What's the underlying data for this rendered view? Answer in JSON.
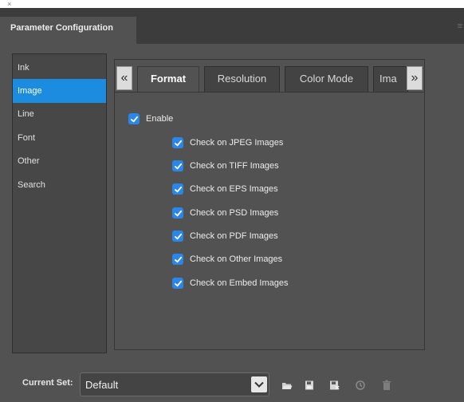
{
  "window": {
    "close_glyph": "×",
    "panel_title": "Parameter Configuration",
    "menu_glyph": "≡"
  },
  "sidebar": {
    "items": [
      {
        "label": "Ink",
        "selected": false
      },
      {
        "label": "Image",
        "selected": true
      },
      {
        "label": "Line",
        "selected": false
      },
      {
        "label": "Font",
        "selected": false
      },
      {
        "label": "Other",
        "selected": false
      },
      {
        "label": "Search",
        "selected": false
      }
    ]
  },
  "tabs": {
    "prev_glyph": "«",
    "next_glyph": "»",
    "items": [
      {
        "label": "Format",
        "active": true
      },
      {
        "label": "Resolution",
        "active": false
      },
      {
        "label": "Color Mode",
        "active": false
      },
      {
        "label": "Ima",
        "active": false
      }
    ]
  },
  "options": {
    "enable": {
      "label": "Enable",
      "checked": true
    },
    "checks": [
      {
        "label": "Check on JPEG Images",
        "checked": true
      },
      {
        "label": "Check on TIFF Images",
        "checked": true
      },
      {
        "label": "Check on EPS Images",
        "checked": true
      },
      {
        "label": "Check on PSD Images",
        "checked": true
      },
      {
        "label": "Check on PDF Images",
        "checked": true
      },
      {
        "label": "Check on Other Images",
        "checked": true
      },
      {
        "label": "Check on Embed Images",
        "checked": true
      }
    ]
  },
  "footer": {
    "current_set_label": "Current Set:",
    "current_set_value": "Default",
    "toolbar_icons": [
      "open-folder-icon",
      "save-icon",
      "save-as-icon",
      "history-icon",
      "trash-icon"
    ]
  },
  "colors": {
    "accent": "#1b8ce0",
    "checkbox": "#2a86e8",
    "panel_bg": "#525252",
    "tabbar_bg": "#3c3c3c"
  }
}
